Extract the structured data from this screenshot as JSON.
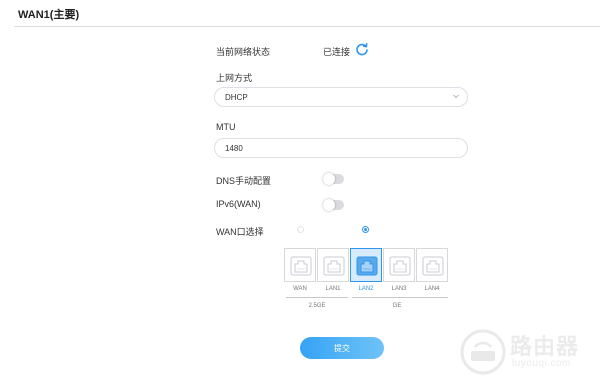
{
  "section": {
    "title": "WAN1(主要)"
  },
  "status": {
    "label": "当前网络状态",
    "value": "已连接",
    "icon": "refresh-icon"
  },
  "connection": {
    "label": "上网方式",
    "value": "DHCP"
  },
  "mtu": {
    "label": "MTU",
    "value": "1480"
  },
  "dns": {
    "label": "DNS手动配置",
    "enabled": false
  },
  "ipv6": {
    "label": "IPv6(WAN)",
    "enabled": false
  },
  "wan_port": {
    "label": "WAN口选择",
    "ports": [
      {
        "label": "WAN",
        "selected": false
      },
      {
        "label": "LAN1",
        "selected": false
      },
      {
        "label": "LAN2",
        "selected": true
      },
      {
        "label": "LAN3",
        "selected": false
      },
      {
        "label": "LAN4",
        "selected": false
      }
    ],
    "groups": [
      "2.5GE",
      "GE"
    ]
  },
  "submit_label": "提交",
  "watermark": {
    "text": "路由器",
    "sub": "luyouqi.com"
  },
  "colors": {
    "accent": "#2e95f0",
    "selected_bg": "#d8ebfc",
    "toggle_off": "#d9dbe0"
  }
}
